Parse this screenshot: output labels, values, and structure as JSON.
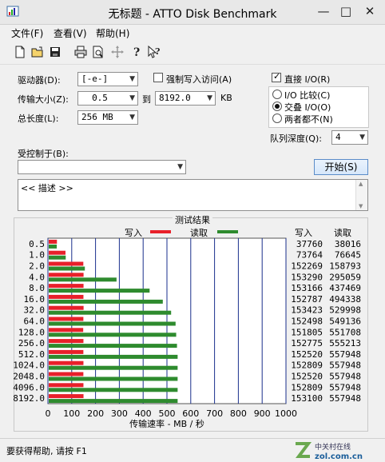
{
  "window": {
    "title": "无标题 - ATTO Disk Benchmark"
  },
  "menu": [
    "文件(F)",
    "查看(V)",
    "帮助(H)"
  ],
  "toolbar": {
    "icons": [
      "new-icon",
      "open-icon",
      "save-icon",
      "print-icon",
      "print-preview-icon",
      "move-icon",
      "help-icon",
      "context-help-icon"
    ]
  },
  "settings": {
    "drive_label": "驱动器(D):",
    "drive_value": "[-e-]",
    "force_write_label": "强制写入访问(A)",
    "transfer_label": "传输大小(Z):",
    "transfer_from": "0.5",
    "to_label": "到",
    "transfer_to": "8192.0",
    "kb_label": "KB",
    "length_label": "总长度(L):",
    "length_value": "256 MB",
    "direct_io_label": "直接 I/O(R)",
    "io_options": [
      "I/O 比较(C)",
      "交叠 I/O(O)",
      "两者都不(N)"
    ],
    "io_selected": "交叠 I/O(O)",
    "queue_label": "队列深度(Q):",
    "queue_value": "4",
    "controlled_label": "受控制于(B):",
    "controlled_value": "",
    "start_label": "开始(S)",
    "description": "<< 描述 >>"
  },
  "results": {
    "title": "测试结果",
    "legend_write": "写入",
    "legend_read": "读取",
    "col_write": "写入",
    "col_read": "读取",
    "xlabel": "传输速率 - MB / 秒",
    "write_color": "#e8202a",
    "read_color": "#2e8b2e"
  },
  "chart_data": {
    "type": "bar",
    "orientation": "horizontal",
    "title": "测试结果",
    "xlabel": "传输速率 - MB / 秒",
    "xlim": [
      0,
      1000
    ],
    "xticks": [
      0,
      100,
      200,
      300,
      400,
      500,
      600,
      700,
      800,
      900,
      1000
    ],
    "categories": [
      "0.5",
      "1.0",
      "2.0",
      "4.0",
      "8.0",
      "16.0",
      "32.0",
      "64.0",
      "128.0",
      "256.0",
      "512.0",
      "1024.0",
      "2048.0",
      "4096.0",
      "8192.0"
    ],
    "series": [
      {
        "name": "写入",
        "values_mb": [
          37.8,
          73.8,
          148.7,
          149.7,
          149.6,
          149.2,
          149.8,
          148.9,
          148.2,
          149.2,
          148.9,
          149.2,
          148.9,
          149.2,
          149.5
        ],
        "raw_kb": [
          "37760",
          "73764",
          "152269",
          "153290",
          "153166",
          "152787",
          "153423",
          "152498",
          "151805",
          "152775",
          "152520",
          "152809",
          "152520",
          "152809",
          "153100"
        ]
      },
      {
        "name": "读取",
        "values_mb": [
          37.1,
          74.8,
          155.1,
          288.2,
          427.2,
          482.6,
          517.5,
          536.3,
          538.8,
          542.2,
          544.9,
          544.9,
          544.9,
          544.9,
          544.9
        ],
        "raw_kb": [
          "38016",
          "76645",
          "158793",
          "295059",
          "437469",
          "494338",
          "529998",
          "549136",
          "551708",
          "555213",
          "557948",
          "557948",
          "557948",
          "557948",
          "557948"
        ]
      }
    ]
  },
  "status": {
    "text": "要获得帮助, 请按 F1",
    "watermark": "中关村在线 zol.com.cn"
  }
}
